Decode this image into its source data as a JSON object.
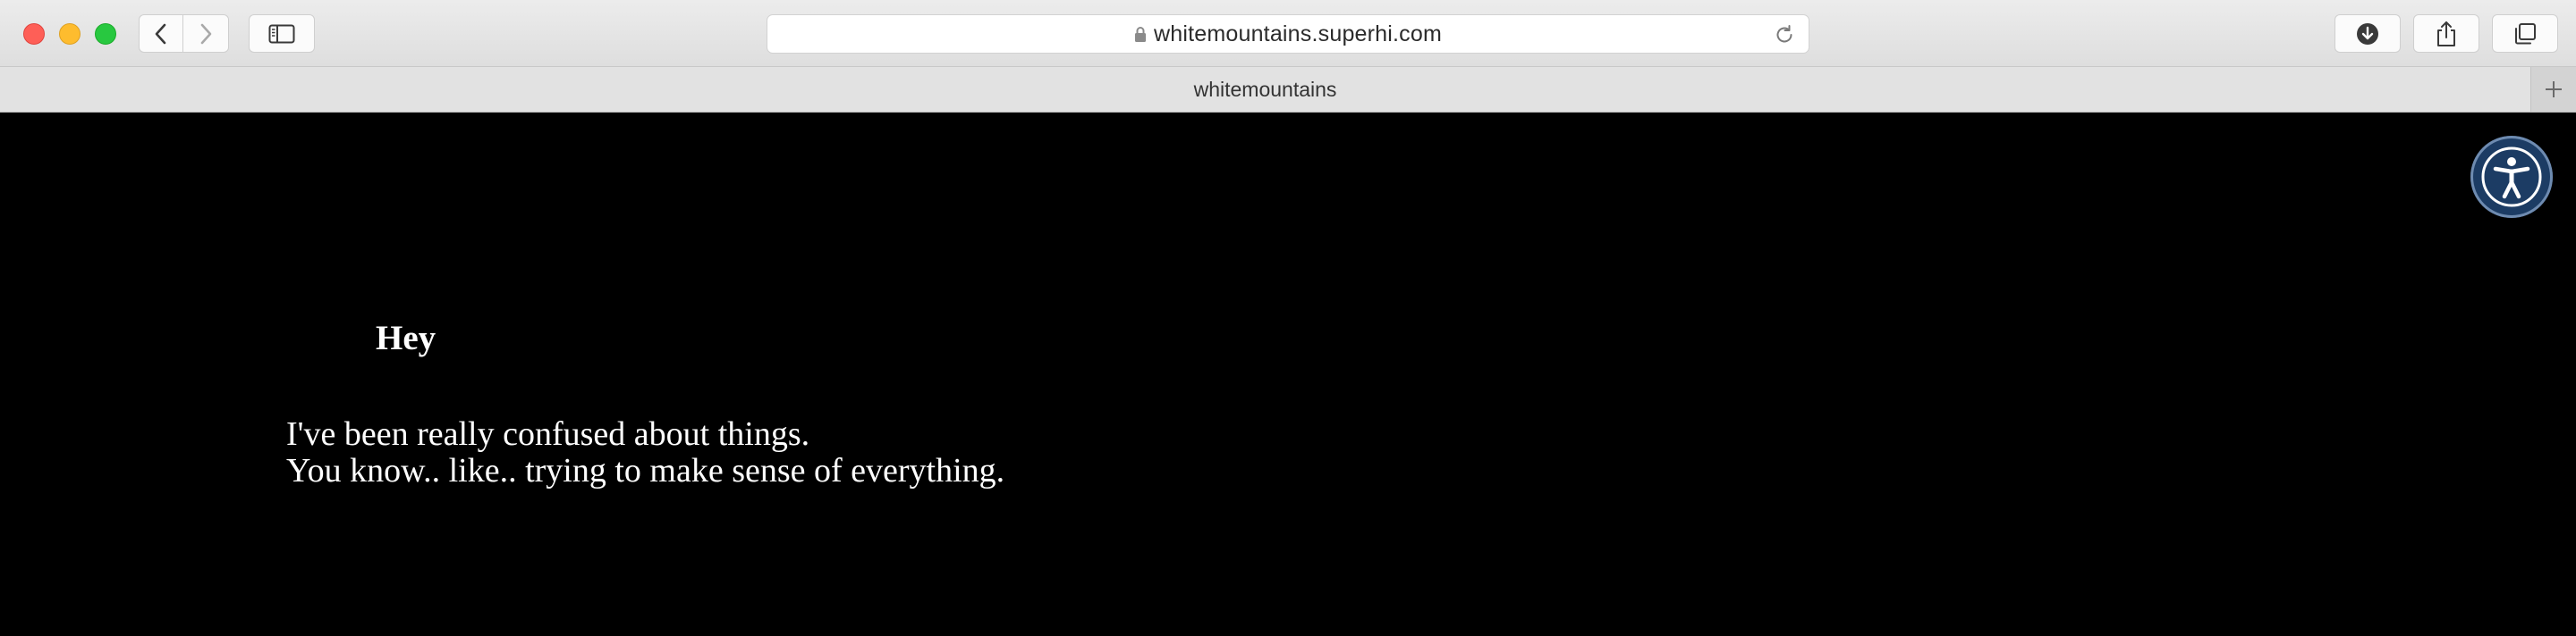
{
  "browser": {
    "address_bar": {
      "url": "whitemountains.superhi.com"
    },
    "tab": {
      "title": "whitemountains"
    },
    "icons": {
      "back": "chevron-left-icon",
      "forward": "chevron-right-icon",
      "sidebar": "sidebar-icon",
      "lock": "lock-icon",
      "reload": "reload-icon",
      "download": "download-icon",
      "share": "share-icon",
      "tabs": "tab-overview-icon",
      "new_tab": "plus-icon"
    }
  },
  "page": {
    "greeting": "Hey",
    "lines": [
      "I've been really confused about things.",
      "You know.. like.. trying to make sense of everything."
    ],
    "accessibility_widget": {
      "icon": "accessibility-icon",
      "color": "#1c3c64"
    },
    "background_color": "#000000",
    "text_color": "#ffffff"
  }
}
